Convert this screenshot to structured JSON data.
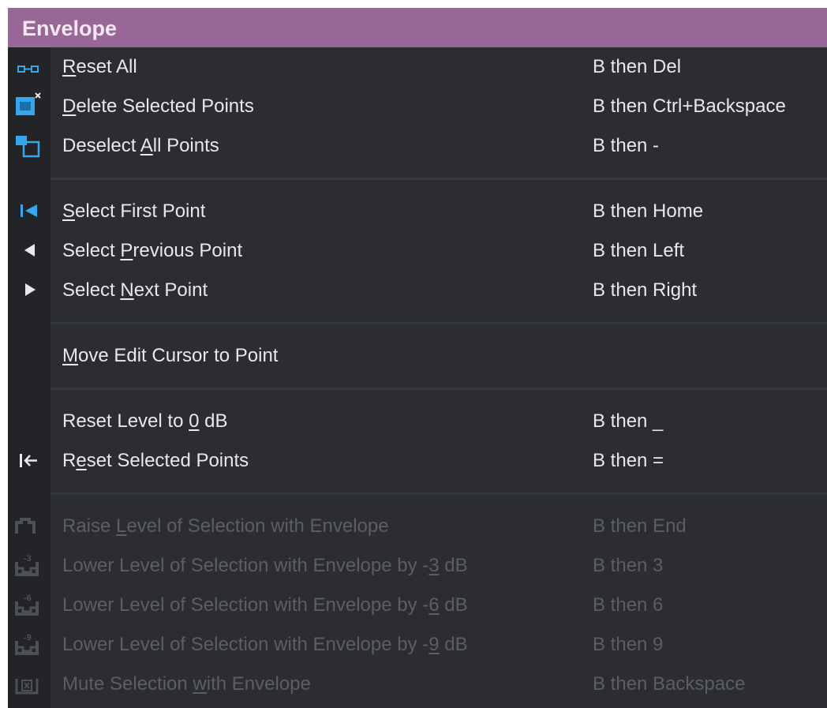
{
  "menu": {
    "title": "Envelope",
    "groups": [
      [
        {
          "name": "reset-all",
          "icon": "reset-envelope-icon",
          "label_parts": [
            "",
            "R",
            "eset All"
          ],
          "shortcut": "B then Del",
          "enabled": true
        },
        {
          "name": "delete-selected-points",
          "icon": "delete-points-icon",
          "label_parts": [
            "",
            "D",
            "elete Selected Points"
          ],
          "shortcut": "B then Ctrl+Backspace",
          "enabled": true
        },
        {
          "name": "deselect-all-points",
          "icon": "deselect-points-icon",
          "label_parts": [
            "Deselect ",
            "A",
            "ll Points"
          ],
          "shortcut": "B then -",
          "enabled": true
        }
      ],
      [
        {
          "name": "select-first-point",
          "icon": "skip-to-first-icon",
          "label_parts": [
            "",
            "S",
            "elect First Point"
          ],
          "shortcut": "B then Home",
          "enabled": true
        },
        {
          "name": "select-previous-point",
          "icon": "triangle-left-icon",
          "label_parts": [
            "Select ",
            "P",
            "revious Point"
          ],
          "shortcut": "B then Left",
          "enabled": true
        },
        {
          "name": "select-next-point",
          "icon": "triangle-right-icon",
          "label_parts": [
            "Select ",
            "N",
            "ext Point"
          ],
          "shortcut": "B then Right",
          "enabled": true
        }
      ],
      [
        {
          "name": "move-edit-cursor-to-point",
          "icon": "",
          "label_parts": [
            "",
            "M",
            "ove Edit Cursor to Point"
          ],
          "shortcut": "",
          "enabled": true
        }
      ],
      [
        {
          "name": "reset-level-to-0db",
          "icon": "",
          "label_parts": [
            "Reset Level to ",
            "0",
            " dB"
          ],
          "shortcut": "B then _",
          "enabled": true
        },
        {
          "name": "reset-selected-points",
          "icon": "arrow-to-left-bar-icon",
          "label_parts": [
            "R",
            "e",
            "set Selected Points"
          ],
          "shortcut": "B then =",
          "enabled": true
        }
      ],
      [
        {
          "name": "raise-level-of-selection",
          "icon": "raise-level-icon",
          "label_parts": [
            "Raise ",
            "L",
            "evel of Selection with Envelope"
          ],
          "shortcut": "B then End",
          "enabled": false
        },
        {
          "name": "lower-level-3db",
          "icon": "lower-level-3db-icon",
          "label_parts": [
            "Lower Level of Selection with Envelope by -",
            "3",
            " dB"
          ],
          "shortcut": "B then 3",
          "enabled": false
        },
        {
          "name": "lower-level-6db",
          "icon": "lower-level-6db-icon",
          "label_parts": [
            "Lower Level of Selection with Envelope by -",
            "6",
            " dB"
          ],
          "shortcut": "B then 6",
          "enabled": false
        },
        {
          "name": "lower-level-9db",
          "icon": "lower-level-9db-icon",
          "label_parts": [
            "Lower Level of Selection with Envelope by -",
            "9",
            " dB"
          ],
          "shortcut": "B then 9",
          "enabled": false
        },
        {
          "name": "mute-selection",
          "icon": "mute-selection-icon",
          "label_parts": [
            "Mute Selection ",
            "w",
            "ith Envelope"
          ],
          "shortcut": "B then Backspace",
          "enabled": false
        }
      ]
    ]
  },
  "icon_glyphs": {
    "lower-level-3db-icon": "-3",
    "lower-level-6db-icon": "-6",
    "lower-level-9db-icon": "-9"
  },
  "colors": {
    "header_bg": "#996795",
    "menu_bg": "#2b2d31",
    "gutter_bg": "#222428",
    "accent_blue": "#35a7ea",
    "text": "#e6e8eb",
    "disabled_text": "#5b5e63"
  }
}
